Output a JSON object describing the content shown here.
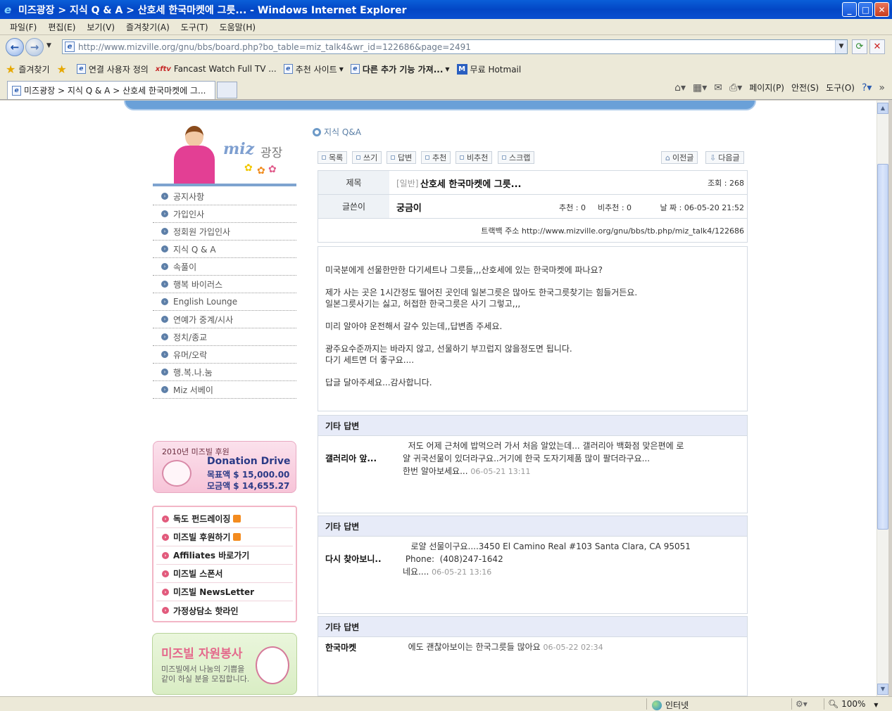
{
  "window": {
    "title": "미즈광장 > 지식 Q & A > 산호세 한국마켓에 그릇... - Windows Internet Explorer"
  },
  "menu": [
    "파일(F)",
    "편집(E)",
    "보기(V)",
    "즐겨찾기(A)",
    "도구(T)",
    "도움말(H)"
  ],
  "address": {
    "url": "http://www.mizville.org/gnu/bbs/board.php?bo_table=miz_talk4&wr_id=122686&page=2491"
  },
  "favorites": {
    "label": "즐겨찾기",
    "items": [
      "연결 사용자 정의",
      "Fancast  Watch Full TV ...",
      "추천 사이트",
      "다른 추가 기능 가져...",
      "무료 Hotmail"
    ]
  },
  "tab": {
    "label": "미즈광장 > 지식 Q & A > 산호세 한국마켓에 그..."
  },
  "commands": [
    "페이지(P)",
    "안전(S)",
    "도구(O)"
  ],
  "site": {
    "logo_word": "miz",
    "logo_title": "광장",
    "side_menu": [
      "공지사항",
      "가입인사",
      "정회원 가입인사",
      "지식 Q & A",
      "속풀이",
      "행복 바이러스",
      "English Lounge",
      "연예가 중계/시사",
      "정치/종교",
      "유머/오락",
      "행.복.나.눔",
      "Miz 서베이"
    ],
    "donation": {
      "head": "2010년 미즈빌 후원",
      "title": "Donation Drive",
      "target": "목표액 $ 15,000.00",
      "raised": "모금액 $ 14,655.27"
    },
    "links": [
      "독도 펀드레이징",
      "미즈빌 후원하기",
      "Affiliates 바로가기",
      "미즈빌 스폰서",
      "미즈빌 NewsLetter",
      "가정상담소 핫라인"
    ],
    "volunteer": {
      "title": "미즈빌 자원봉사",
      "text_line1": "미즈빌에서 나눔의 기쁨을",
      "text_line2": "같이 하실 분을 모집합니다."
    }
  },
  "board": {
    "title": "지식 Q&A",
    "buttons": [
      "목록",
      "쓰기",
      "답변",
      "추천",
      "비추천",
      "스크랩"
    ],
    "prev_label": "이전글",
    "next_label": "다음글"
  },
  "post": {
    "subject_label": "제목",
    "category": "[일반]",
    "subject": "산호세 한국마켓에 그릇...",
    "views": "조회 : 268",
    "writer_label": "글쓴이",
    "writer": "궁금이",
    "recommend": "추천 : 0",
    "not_recommend": "비추천 : 0",
    "date": "날  짜 : 06-05-20 21:52",
    "trackback": "트랙백 주소 http://www.mizville.org/gnu/bbs/tb.php/miz_talk4/122686",
    "body": [
      "미국분에게 선물한만한 다기세트나 그릇들,,,산호세에 있는 한국마켓에 파나요?",
      "제가 사는 곳은 1시간정도 떨어진 곳인데 일본그릇은 많아도 한국그릇찾기는 힘들거든요.",
      "일본그릇사기는 싫고, 허접한 한국그릇은 사기 그렇고,,,",
      "미리 알아야 운전해서 갈수 있는데,,답변좀 주세요.",
      "광주요수준까지는 바라지 않고, 선물하기 부끄럽지 않을정도면 됩니다.",
      "다기 세트면 더 좋구요....",
      "답글 달아주세요...감사합니다."
    ]
  },
  "replies": [
    {
      "head": "기타 답변",
      "name": "갤러리아 앞...",
      "lines": [
        "  저도 어제 근처에 밥먹으러 가서 처음 알았는데... 갤러리아 백화점 맞은편에 로",
        "얄 귀국선물이 있더라구요..거기에 한국 도자기제품 많이 팔더라구요...",
        "한번 알아보세요..."
      ],
      "time": "06-05-21 13:11"
    },
    {
      "head": "기타 답변",
      "name": "다시 찾아보니..",
      "lines": [
        "   로얄 선물이구요....3450 El Camino Real #103 Santa Clara, CA 95051",
        " Phone:  (408)247-1642",
        "네요...."
      ],
      "time": "06-05-21 13:16"
    },
    {
      "head": "기타 답변",
      "name": "한국마켓",
      "lines": [
        "  에도 괜찮아보이는 한국그릇들 많아요"
      ],
      "time": "06-05-22 02:34"
    }
  ],
  "status": {
    "zone": "인터넷",
    "zoom": "100%"
  }
}
